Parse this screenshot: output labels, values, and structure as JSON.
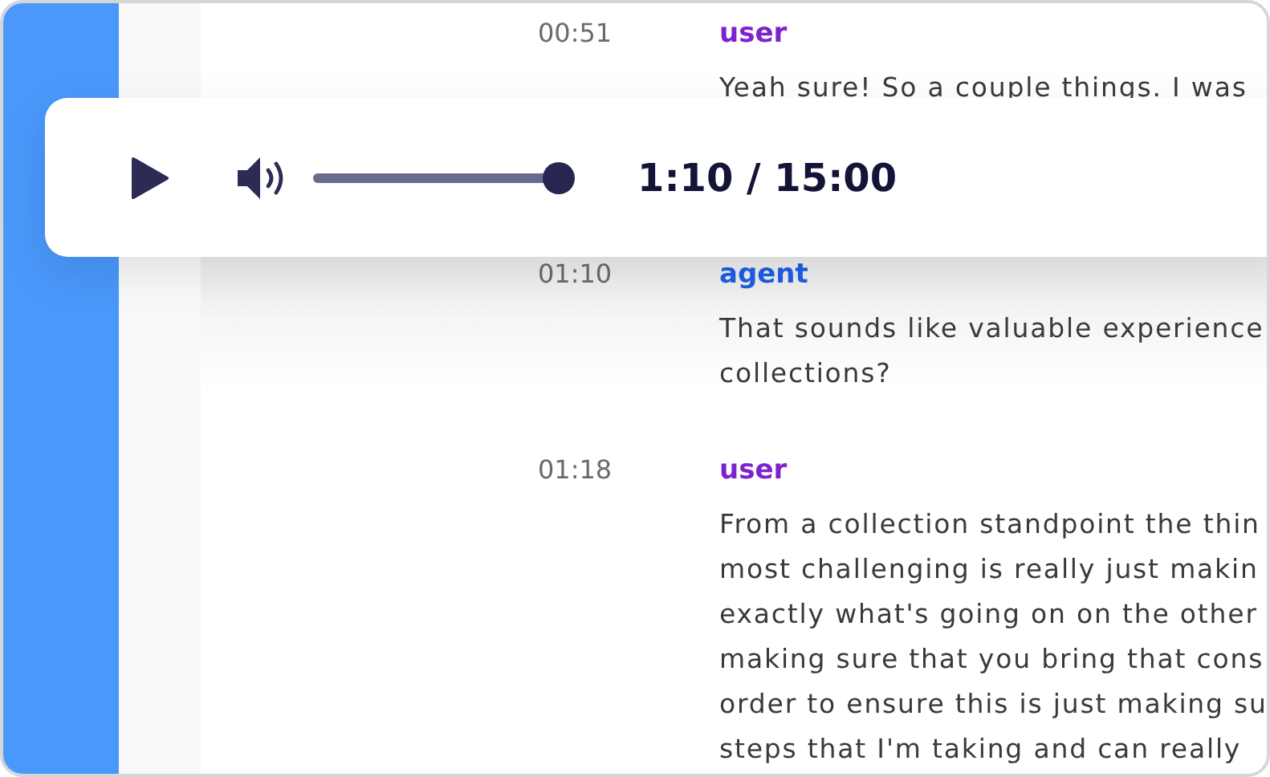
{
  "player": {
    "time": "1:10 / 15:00",
    "volume": {
      "level": 1.0
    }
  },
  "messages": [
    {
      "time": "00:51",
      "speaker": "user",
      "color": "#7e22ce",
      "lines": [
        "Yeah sure! So a couple things. I was"
      ]
    },
    {
      "time": "01:10",
      "speaker": "agent",
      "color": "#1d5fe8",
      "lines": [
        "That sounds like valuable experience",
        "collections?"
      ]
    },
    {
      "time": "01:18",
      "speaker": "user",
      "color": "#7e22ce",
      "lines": [
        "From a collection standpoint the thin",
        "most challenging is really just makin",
        "exactly what's going on on the other",
        "making sure that you bring that cons",
        "order to ensure this is just making su",
        "steps that I'm taking and can really"
      ]
    }
  ]
}
